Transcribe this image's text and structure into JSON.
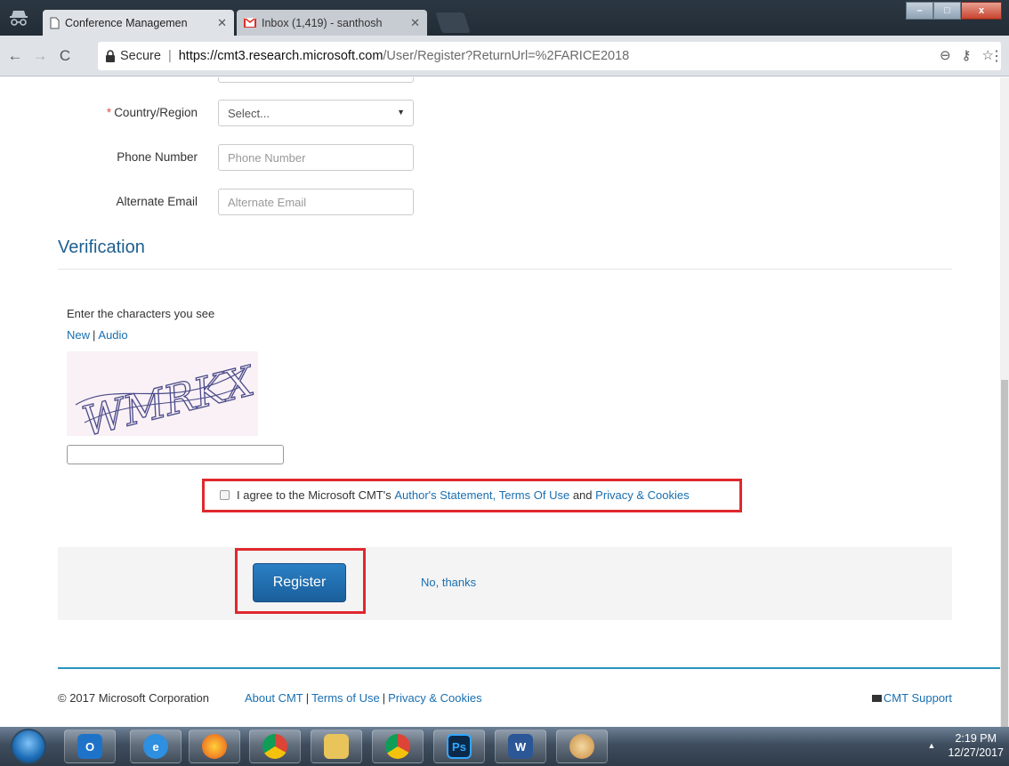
{
  "browser": {
    "tabs": [
      {
        "label": "Conference Managemen",
        "icon": "page-icon",
        "active": true
      },
      {
        "label": "Inbox (1,419) - santhosh",
        "icon": "gmail-icon",
        "active": false
      }
    ],
    "window_controls": {
      "minimize": "–",
      "maximize": "□",
      "close": "x"
    },
    "address": {
      "secure_label": "Secure",
      "separator": "|",
      "url_scheme": "https://",
      "url_host": "cmt3.research.microsoft.com",
      "url_path": "/User/Register?ReturnUrl=%2FARICE2018"
    },
    "nav": {
      "back": "←",
      "forward": "→",
      "reload": "C"
    },
    "omnibox_icons": {
      "zoom": "⊖",
      "key": "⚷",
      "star": "☆",
      "menu": "⋮"
    }
  },
  "form": {
    "country": {
      "required_mark": "*",
      "label": "Country/Region",
      "value": "Select...",
      "caret": "▼"
    },
    "phone": {
      "label": "Phone Number",
      "placeholder": "Phone Number"
    },
    "alt_email": {
      "label": "Alternate Email",
      "placeholder": "Alternate Email"
    }
  },
  "verification": {
    "title": "Verification",
    "prompt": "Enter the characters you see",
    "new_link": "New",
    "bar": "|",
    "audio_link": "Audio",
    "captcha_text": "WMRKX"
  },
  "agreement": {
    "prefix": "I agree to the Microsoft CMT's",
    "authors_statement": "Author's Statement,",
    "terms": "Terms Of Use",
    "and": "and",
    "privacy": "Privacy & Cookies"
  },
  "actions": {
    "register": "Register",
    "no_thanks": "No, thanks"
  },
  "footer": {
    "copyright": "© 2017 Microsoft Corporation",
    "about": "About CMT",
    "terms": "Terms of Use",
    "privacy": "Privacy & Cookies",
    "bar": "|",
    "support": "CMT Support"
  },
  "taskbar": {
    "apps": [
      "outlook-icon",
      "ie-icon",
      "firefox-icon",
      "chrome-icon",
      "explorer-icon",
      "chrome-icon",
      "photoshop-icon",
      "word-icon",
      "paint-icon"
    ],
    "ps_label": "Ps",
    "word_label": "W",
    "tray_arrow": "▲",
    "time": "2:19 PM",
    "date": "12/27/2017"
  }
}
